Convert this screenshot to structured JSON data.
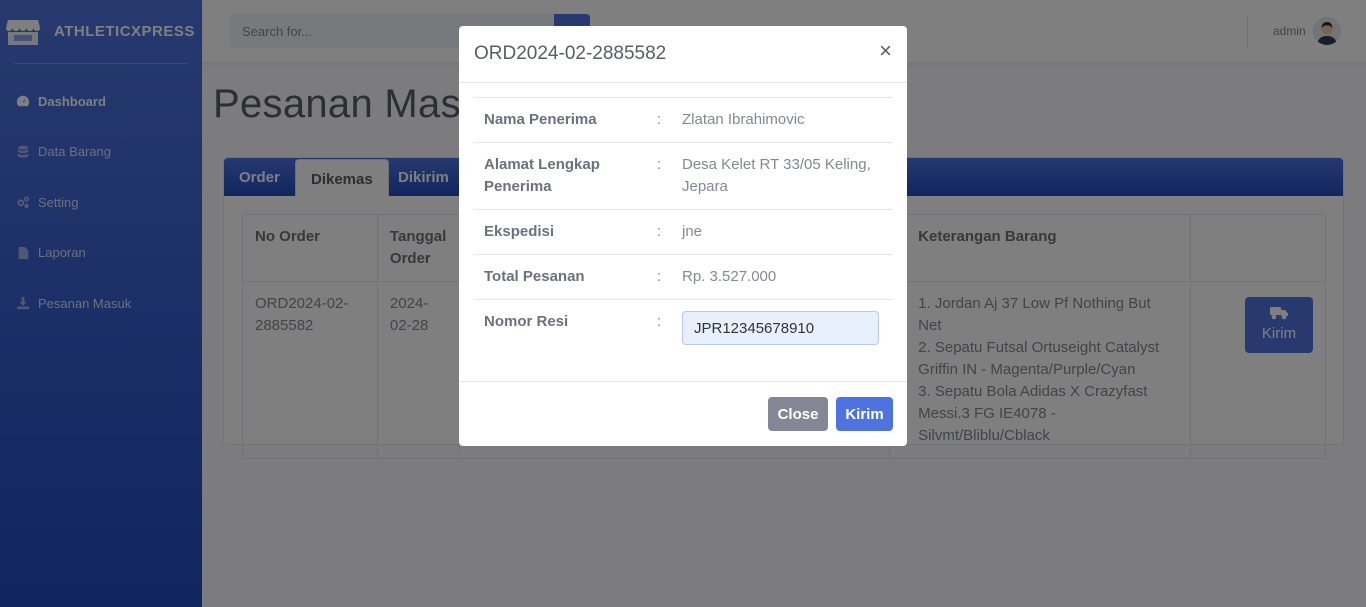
{
  "brand": {
    "name": "ATHLETICXPRESS"
  },
  "sidebar": {
    "items": [
      {
        "label": "Dashboard",
        "icon": "dashboard-icon",
        "active": true
      },
      {
        "label": "Data Barang",
        "icon": "database-icon"
      },
      {
        "label": "Setting",
        "icon": "cogs-icon"
      },
      {
        "label": "Laporan",
        "icon": "file-icon"
      },
      {
        "label": "Pesanan Masuk",
        "icon": "download-icon"
      }
    ]
  },
  "topbar": {
    "search_placeholder": "Search for...",
    "user_name": "admin"
  },
  "page": {
    "title": "Pesanan Masuk"
  },
  "tabs": [
    "Order",
    "Dikemas",
    "Dikirim"
  ],
  "table": {
    "headers": [
      "No Order",
      "Tanggal Order",
      "",
      "Keterangan Barang",
      ""
    ],
    "row": {
      "no_order": "ORD2024-02-2885582",
      "tanggal": "2024-02-28",
      "items": [
        "1. Jordan Aj 37 Low Pf Nothing But Net",
        "2. Sepatu Futsal Ortuseight Catalyst Griffin IN - Magenta/Purple/Cyan",
        "3. Sepatu Bola Adidas X Crazyfast Messi.3 FG IE4078 - Silvmt/Bliblu/Cblack"
      ],
      "action_label": "Kirim"
    }
  },
  "modal": {
    "title": "ORD2024-02-2885582",
    "close_symbol": "×",
    "fields": [
      {
        "label": "Nama Penerima",
        "value": "Zlatan Ibrahimovic"
      },
      {
        "label": "Alamat Lengkap Penerima",
        "value": "Desa Kelet RT 33/05 Keling, Jepara"
      },
      {
        "label": "Ekspedisi",
        "value": "jne"
      },
      {
        "label": "Total Pesanan",
        "value": "Rp. 3.527.000"
      }
    ],
    "resi": {
      "label": "Nomor Resi",
      "value": "JPR12345678910"
    },
    "colon": ":",
    "close_label": "Close",
    "submit_label": "Kirim"
  },
  "colors": {
    "primary": "#4e73df",
    "secondary": "#858796",
    "sidebar_dark": "#224abe"
  }
}
